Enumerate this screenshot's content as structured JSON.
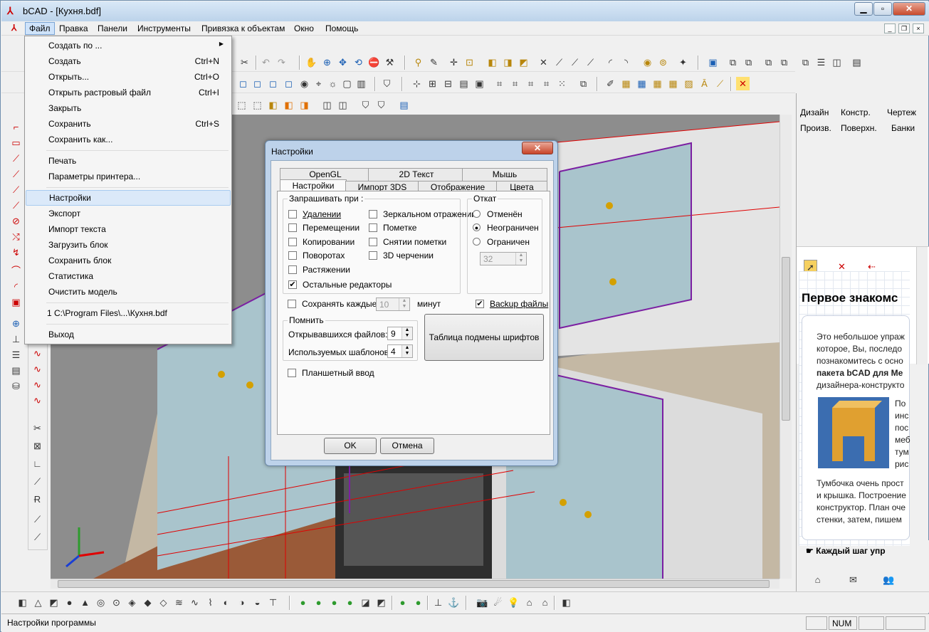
{
  "app": {
    "title": "bCAD - [Кухня.bdf]",
    "icon": "bcad-app-icon"
  },
  "menubar": {
    "items": [
      "Файл",
      "Правка",
      "Панели",
      "Инструменты",
      "Привязка к объектам",
      "Окно",
      "Помощь"
    ]
  },
  "file_menu": {
    "items": [
      {
        "label": "Создать по ...",
        "shortcut": "",
        "arrow": "▶"
      },
      {
        "label": "Создать",
        "shortcut": "Ctrl+N"
      },
      {
        "label": "Открыть...",
        "shortcut": "Ctrl+O"
      },
      {
        "label": "Открыть растровый файл",
        "shortcut": "Ctrl+I"
      },
      {
        "label": "Закрыть",
        "shortcut": ""
      },
      {
        "label": "Сохранить",
        "shortcut": "Ctrl+S"
      },
      {
        "label": "Сохранить как...",
        "shortcut": ""
      },
      {
        "label": "Печать",
        "shortcut": ""
      },
      {
        "label": "Параметры принтера...",
        "shortcut": ""
      },
      {
        "label": "Настройки",
        "shortcut": ""
      },
      {
        "label": "Экспорт",
        "shortcut": ""
      },
      {
        "label": "Импорт текста",
        "shortcut": ""
      },
      {
        "label": "Загрузить блок",
        "shortcut": ""
      },
      {
        "label": "Сохранить блок",
        "shortcut": ""
      },
      {
        "label": "Статистика",
        "shortcut": ""
      },
      {
        "label": "Очистить модель",
        "shortcut": ""
      },
      {
        "label": "1 C:\\Program Files\\...\\Кухня.bdf",
        "shortcut": ""
      },
      {
        "label": "Выход",
        "shortcut": ""
      }
    ],
    "highlighted": "Настройки"
  },
  "dialog": {
    "title": "Настройки",
    "close": "✕",
    "tabs_row1": [
      "OpenGL",
      "2D Текст",
      "Мышь"
    ],
    "tabs_row2": [
      "Настройки",
      "Импорт 3DS",
      "Отображение",
      "Цвета"
    ],
    "active_tab": "Настройки",
    "confirm_group": {
      "label": "Запрашивать при :",
      "left": [
        {
          "label": "Удалении",
          "checked": false
        },
        {
          "label": "Перемещении",
          "checked": false
        },
        {
          "label": "Копировании",
          "checked": false
        },
        {
          "label": "Поворотах",
          "checked": false
        },
        {
          "label": "Растяжении",
          "checked": false
        },
        {
          "label": "Остальные редакторы",
          "checked": true
        }
      ],
      "right": [
        {
          "label": "Зеркальном отражении",
          "checked": false
        },
        {
          "label": "Пометке",
          "checked": false
        },
        {
          "label": "Снятии пометки",
          "checked": false
        },
        {
          "label": "3D черчении",
          "checked": false
        }
      ]
    },
    "undo_group": {
      "label": "Откат",
      "options": [
        "Отменён",
        "Неограничен",
        "Ограничен"
      ],
      "selected": "Неограничен",
      "limit_value": "32"
    },
    "autosave": {
      "label": "Сохранять каждые",
      "checked": false,
      "value": "10",
      "unit": "минут"
    },
    "backup": {
      "label": "Backup файлы",
      "checked": true
    },
    "remember_group": {
      "label": "Помнить",
      "opened_label": "Открывавшихся файлов:",
      "opened_value": "9",
      "templates_label": "Используемых шаблонов:",
      "templates_value": "4"
    },
    "font_table_button": "Таблица подмены шрифтов",
    "tablet": {
      "label": "Планшетный ввод",
      "checked": false
    },
    "ok": "OK",
    "cancel": "Отмена"
  },
  "right_panel": {
    "tabs_row1": [
      "Дизайн",
      "Констр.",
      "Чертеж"
    ],
    "tabs_row2": [
      "Произв.",
      "Поверхн.",
      "Банки"
    ],
    "help_title": "Первое знакомс",
    "help_lines_top": [
      "Это небольшое упраж",
      "которое, Вы, последо",
      "познакомитесь с осно",
      "пакета bCAD для Ме",
      "дизайнера-конструкто"
    ],
    "help_lines_side": [
      "По",
      "инс",
      "пос",
      "меб",
      "тум",
      "рис"
    ],
    "help_lines_bottom": [
      "Тумбочка очень прост",
      "и крышка. Построение",
      "конструктор. План оче",
      "стенки, затем, пишем"
    ],
    "help_footer": "Каждый шаг упр"
  },
  "status": {
    "text": "Настройки программы",
    "num": "NUM"
  },
  "colors": {
    "dialog_frame": "#bdd2ea",
    "menu_highlight": "#dbe9f9",
    "viewport_bg": "#8c8c8c"
  }
}
